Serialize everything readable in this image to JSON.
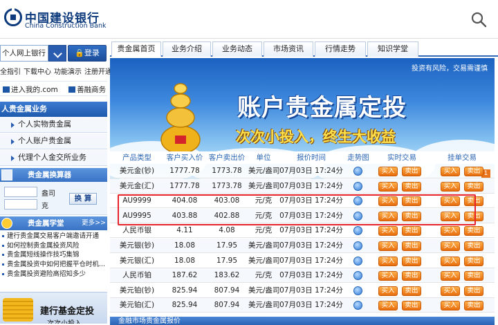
{
  "header": {
    "logo_cn": "中国建设银行",
    "logo_en": "China Construction Bank"
  },
  "sidebar": {
    "login_select": "个人网上银行",
    "login_button": "登录",
    "quick_links": [
      "全指引",
      "下载中心",
      "功能演示",
      "注册开通"
    ],
    "enter_link": "进入我的.com",
    "shop_link": "善融商务",
    "category_title": "人贵金属业务",
    "category_items": [
      "个人实物贵金属",
      "个人账户贵金属",
      "代理个人金交所业务"
    ],
    "calculator_title": "贵金属换算器",
    "calc_unit1": "盎司",
    "calc_unit2": "克",
    "calc_button": "换 算",
    "school_title": "贵金属学堂",
    "school_more": "更多>>",
    "news": [
      "建行贵金属交易客户端邀请开通",
      "如何控制贵金属投资风险",
      "贵金属短线操作技巧集锦",
      "贵金属投资中如何把握平仓时机...",
      "贵金属投资避险高招知多少"
    ],
    "fund_title": "建行基金定投",
    "fund_sub": "次次小投入"
  },
  "tabs": [
    "贵金属首页",
    "业务介绍",
    "业务动态",
    "市场资讯",
    "行情走势",
    "知识学堂"
  ],
  "banner": {
    "slogan": "投资有风险，交易需谨慎",
    "title": "账户贵金属定投",
    "subtitle": "次次小投入，终生大收益",
    "page": "1"
  },
  "quote": {
    "headers": [
      "产品类型",
      "客户买入价",
      "客户卖出价",
      "单位",
      "报价时间",
      "走势图",
      "实时交易",
      "挂单交易"
    ],
    "buy_label": "买入",
    "sell_label": "卖出",
    "rows": [
      {
        "name": "美元金(钞)",
        "buy": "1777.78",
        "sell": "1773.78",
        "unit": "美元/盎司",
        "time": "07月03日 17:24分"
      },
      {
        "name": "美元金(汇)",
        "buy": "1777.78",
        "sell": "1773.78",
        "unit": "美元/盎司",
        "time": "07月03日 17:24分"
      },
      {
        "name": "AU9999",
        "buy": "404.08",
        "sell": "403.08",
        "unit": "元/克",
        "time": "07月03日 17:24分"
      },
      {
        "name": "AU9995",
        "buy": "403.88",
        "sell": "402.88",
        "unit": "元/克",
        "time": "07月03日 17:24分"
      },
      {
        "name": "人民币银",
        "buy": "4.11",
        "sell": "4.08",
        "unit": "元/克",
        "time": "07月03日 17:24分"
      },
      {
        "name": "美元银(钞)",
        "buy": "18.08",
        "sell": "17.95",
        "unit": "美元/盎司",
        "time": "07月03日 17:24分"
      },
      {
        "name": "美元银(汇)",
        "buy": "18.08",
        "sell": "17.95",
        "unit": "美元/盎司",
        "time": "07月03日 17:24分"
      },
      {
        "name": "人民币铂",
        "buy": "187.62",
        "sell": "183.62",
        "unit": "元/克",
        "time": "07月03日 17:24分"
      },
      {
        "name": "美元铂(钞)",
        "buy": "825.94",
        "sell": "807.94",
        "unit": "美元/盎司",
        "time": "07月03日 17:24分"
      },
      {
        "name": "美元铂(汇)",
        "buy": "825.94",
        "sell": "807.94",
        "unit": "美元/盎司",
        "time": "07月03日 17:24分"
      }
    ]
  },
  "bottom_section": "金融市场贵金属报价",
  "colors": {
    "brand_blue": "#0d3a7c",
    "accent_blue": "#2a5db0",
    "button_orange": "#e86d0c",
    "highlight_red": "#e8212b"
  }
}
